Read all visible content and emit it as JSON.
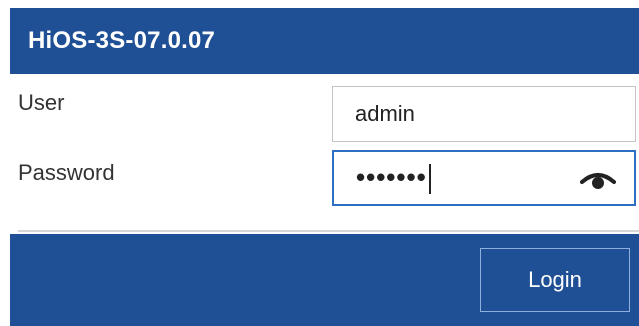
{
  "window": {
    "title": "HiOS-3S-07.0.07"
  },
  "form": {
    "user_label": "User",
    "user_value": "admin",
    "password_label": "Password",
    "password_masked": "•••••••",
    "show_password_icon": "eye-icon"
  },
  "footer": {
    "login_label": "Login"
  },
  "colors": {
    "brand_blue": "#1f4f95",
    "focus_border": "#2c6fc4",
    "button_border": "#8fb0dc"
  }
}
